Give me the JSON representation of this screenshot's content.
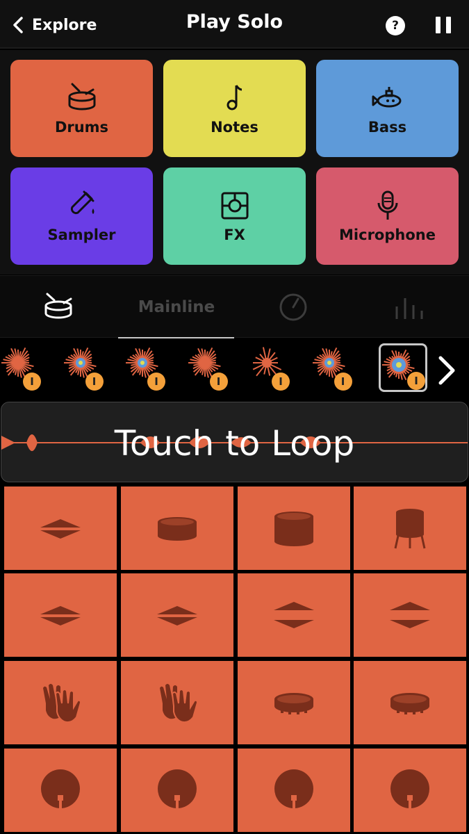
{
  "header": {
    "back_label": "Explore",
    "title": "Play Solo",
    "help_glyph": "?",
    "back_icon": "chevron-left-icon",
    "pause_icon": "pause-icon"
  },
  "instruments": [
    {
      "label": "Drums",
      "icon": "drum-icon",
      "color": "#e06543"
    },
    {
      "label": "Notes",
      "icon": "music-note-icon",
      "color": "#e3dc52"
    },
    {
      "label": "Bass",
      "icon": "submarine-icon",
      "color": "#5e9ad9"
    },
    {
      "label": "Sampler",
      "icon": "test-tube-icon",
      "color": "#6a3de6"
    },
    {
      "label": "FX",
      "icon": "fx-box-icon",
      "color": "#5ed0a5"
    },
    {
      "label": "Microphone",
      "icon": "microphone-icon",
      "color": "#d65a6c"
    }
  ],
  "tabs": {
    "items": [
      {
        "icon": "drum-icon",
        "active": false
      },
      {
        "label": "Mainline",
        "active": true
      },
      {
        "icon": "knob-icon",
        "active": false
      },
      {
        "icon": "equalizer-icon",
        "active": false
      }
    ]
  },
  "samples": {
    "badge_glyph": "I",
    "selected_index": 6,
    "count": 7,
    "next_icon": "chevron-right-icon"
  },
  "loop": {
    "label": "Touch to Loop"
  },
  "pads": {
    "color": "#e06543",
    "icon_color": "#7a2e1b",
    "rows": [
      [
        "hihat-icon",
        "snare-icon",
        "tom-icon",
        "floor-tom-icon"
      ],
      [
        "hihat-icon",
        "hihat-icon",
        "open-hihat-icon",
        "open-hihat-icon"
      ],
      [
        "clap-icon",
        "clap-icon",
        "tambourine-icon",
        "tambourine-icon"
      ],
      [
        "kick-icon",
        "kick-icon",
        "kick-icon",
        "kick-icon"
      ]
    ]
  },
  "colors": {
    "background": "#000000",
    "panel": "#111111",
    "badge": "#f4a03a",
    "pad": "#e06543"
  }
}
